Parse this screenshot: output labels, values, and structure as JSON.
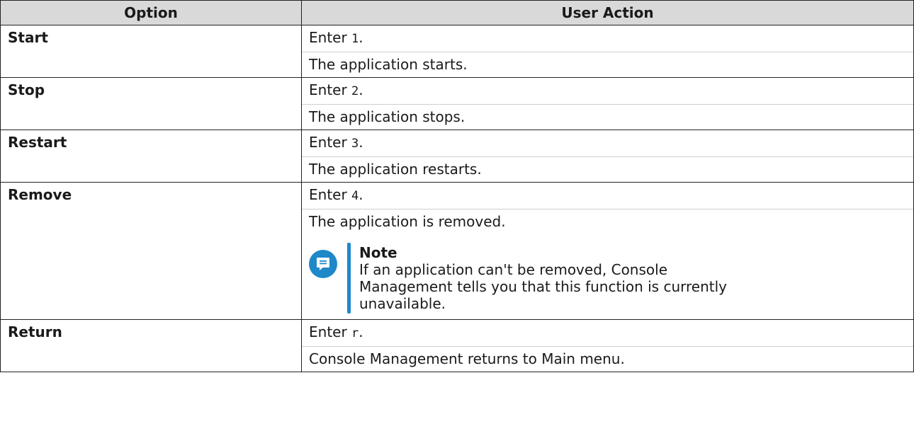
{
  "headers": [
    "Option",
    "User Action"
  ],
  "rows": [
    {
      "option": "Start",
      "prefix": "Enter ",
      "code": "1",
      "suffix": ".",
      "result": "The application starts."
    },
    {
      "option": "Stop",
      "prefix": "Enter ",
      "code": "2",
      "suffix": ".",
      "result": "The application stops."
    },
    {
      "option": "Restart",
      "prefix": "Enter ",
      "code": "3",
      "suffix": ".",
      "result": "The application restarts."
    },
    {
      "option": "Remove",
      "prefix": "Enter ",
      "code": "4",
      "suffix": ".",
      "result": "The application is removed."
    },
    {
      "option": "Return",
      "prefix": "Enter ",
      "code": "r",
      "suffix": ".",
      "result": "Console Management returns to Main menu."
    }
  ],
  "note": {
    "title": "Note",
    "text": "If an application can't be removed, Console Management tells you that this function is currently unavailable.",
    "icon": "note-icon"
  }
}
